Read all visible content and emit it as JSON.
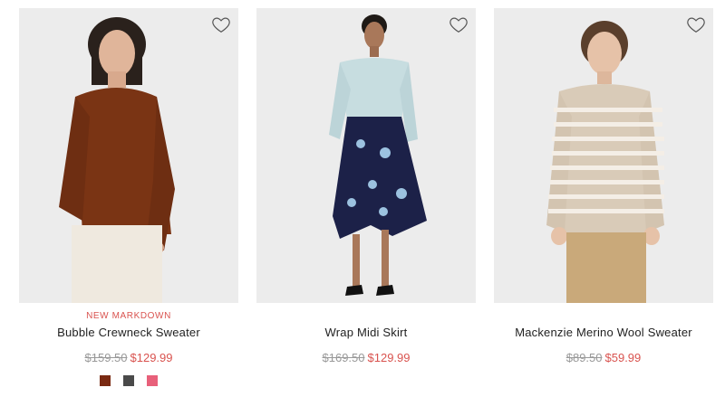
{
  "products": [
    {
      "tag": "NEW MARKDOWN",
      "name": "Bubble Crewneck Sweater",
      "price_original": "$159.50",
      "price_sale": "$129.99",
      "favorite_icon": "heart-outline-icon",
      "swatches": [
        {
          "color": "#7a2a12",
          "label": "rust"
        },
        {
          "color": "#4a4a4a",
          "label": "charcoal"
        },
        {
          "color": "#e8607a",
          "label": "pink"
        }
      ]
    },
    {
      "tag": "",
      "name": "Wrap Midi Skirt",
      "price_original": "$169.50",
      "price_sale": "$129.99",
      "favorite_icon": "heart-outline-icon",
      "swatches": []
    },
    {
      "tag": "",
      "name": "Mackenzie Merino Wool Sweater",
      "price_original": "$89.50",
      "price_sale": "$59.99",
      "favorite_icon": "heart-outline-icon",
      "swatches": []
    }
  ],
  "colors": {
    "sale": "#d9534f",
    "original_price": "#999999",
    "photo_bg": "#ececec"
  }
}
